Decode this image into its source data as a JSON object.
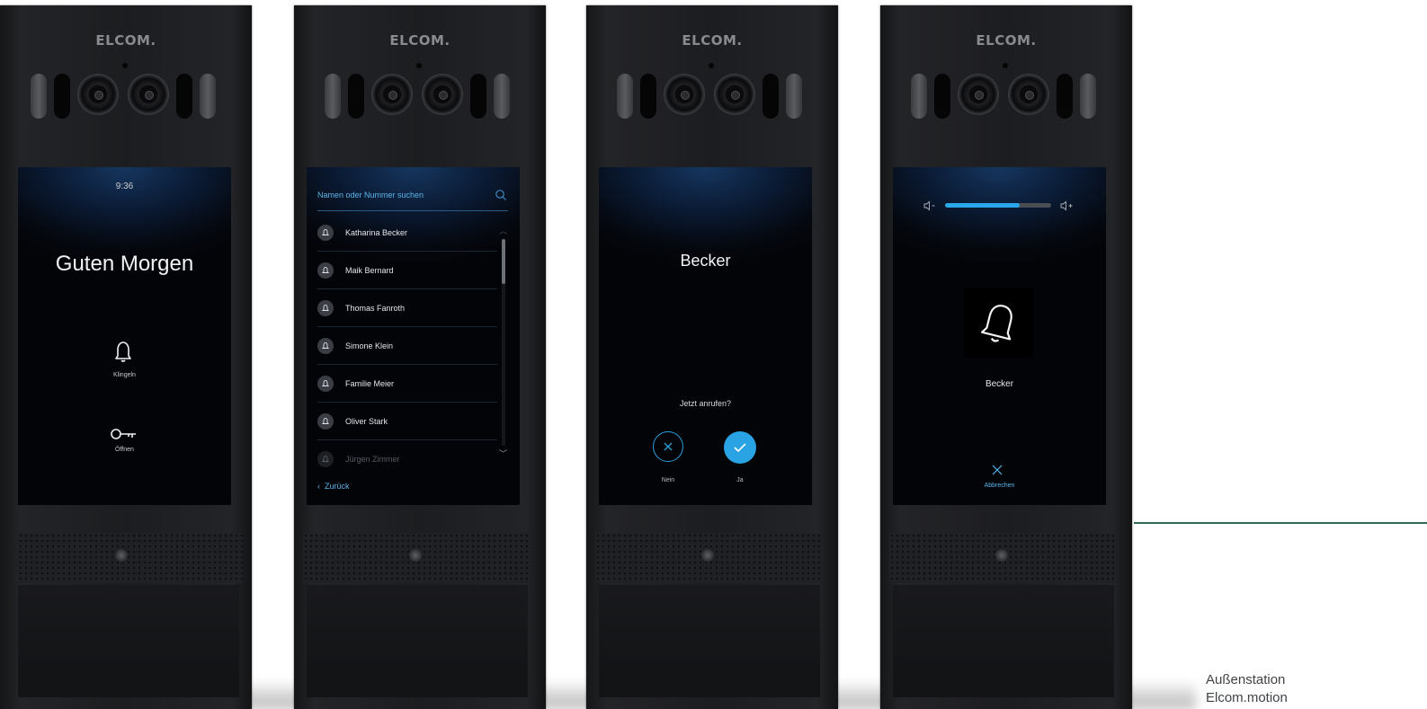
{
  "brand": "ELCOM.",
  "screens": {
    "home": {
      "time": "9:36",
      "greeting": "Guten Morgen",
      "ring_label": "Klingeln",
      "open_label": "Öffnen"
    },
    "directory": {
      "search_placeholder": "Namen oder Nummer suchen",
      "names": [
        "Katharina Becker",
        "Maik Bernard",
        "Thomas Fanroth",
        "Simone Klein",
        "Familie Meier",
        "Oliver Stark",
        "Jürgen Zimmer"
      ],
      "back_label": "Zurück",
      "scroll_position": 0
    },
    "confirm": {
      "name": "Becker",
      "question": "Jetzt anrufen?",
      "no_label": "Nein",
      "yes_label": "Ja"
    },
    "calling": {
      "volume_level": 0.7,
      "name": "Becker",
      "cancel_label": "Abbrechen"
    }
  },
  "caption": {
    "line1": "Außenstation",
    "line2": "Elcom.motion"
  },
  "colors": {
    "accent": "#2aa6ea",
    "rule": "#2f6b55",
    "panel": "#1c1d20"
  }
}
